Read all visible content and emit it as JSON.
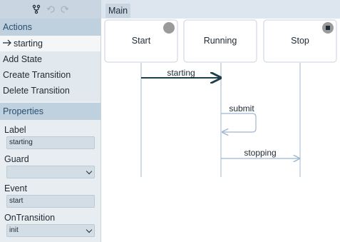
{
  "toolbar": {
    "icons": [
      "branch-icon",
      "undo-icon",
      "redo-icon"
    ]
  },
  "actions": {
    "title": "Actions",
    "selected": "starting",
    "items": [
      "Add State",
      "Create Transition",
      "Delete Transition"
    ]
  },
  "properties": {
    "title": "Properties",
    "label": {
      "name": "Label",
      "value": "starting"
    },
    "guard": {
      "name": "Guard",
      "value": ""
    },
    "event": {
      "name": "Event",
      "value": "start"
    },
    "on_transition": {
      "name": "OnTransition",
      "value": "init"
    }
  },
  "main": {
    "tab": "Main",
    "states": [
      "Start",
      "Running",
      "Stop"
    ],
    "transitions": [
      "starting",
      "submit",
      "stopping"
    ]
  },
  "colors": {
    "accent": "#2a4f6e",
    "state_marker": "#9a9a9a",
    "lifeline": "#9fb8d0",
    "selected_arrow": "#1e3e4c"
  }
}
